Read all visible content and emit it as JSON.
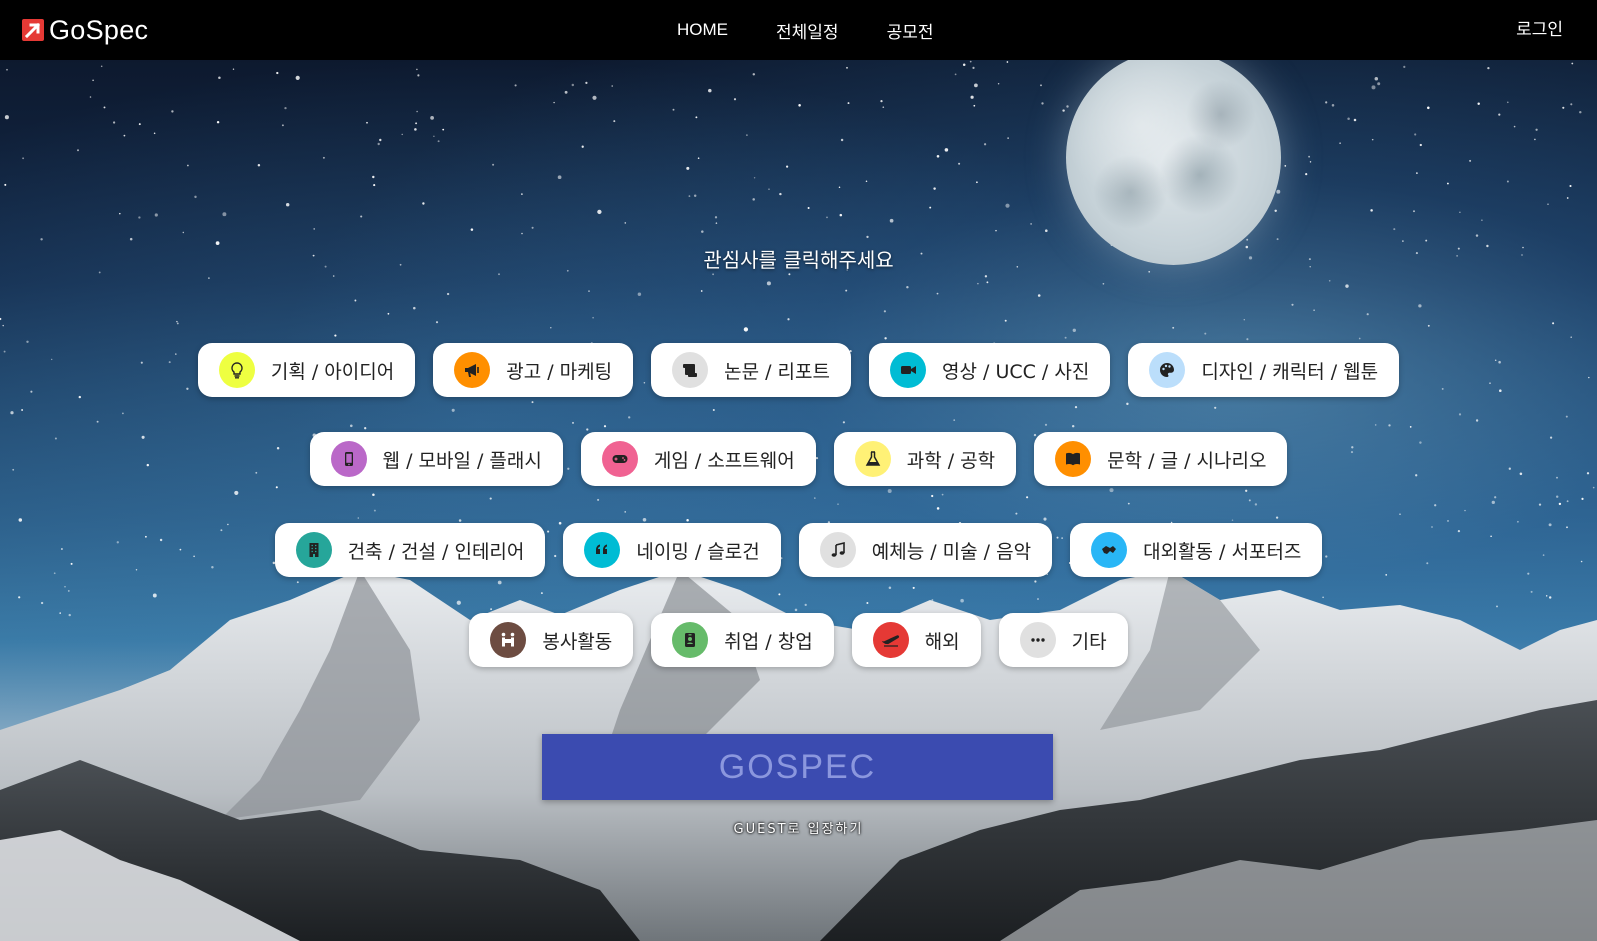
{
  "brand": {
    "name": "GoSpec",
    "color": "#e53935"
  },
  "nav": {
    "items": [
      {
        "label": "HOME"
      },
      {
        "label": "전체일정"
      },
      {
        "label": "공모전"
      }
    ],
    "login_label": "로그인"
  },
  "main": {
    "prompt": "관심사를 클릭해주세요",
    "category_rows": [
      [
        {
          "label": "기획 / 아이디어",
          "icon": "lightbulb-icon",
          "color": "#eeff41"
        },
        {
          "label": "광고 / 마케팅",
          "icon": "megaphone-icon",
          "color": "#ff8f00"
        },
        {
          "label": "논문 / 리포트",
          "icon": "scroll-icon",
          "color": "#e0e0e0"
        },
        {
          "label": "영상 / UCC / 사진",
          "icon": "video-camera-icon",
          "color": "#00bcd4"
        },
        {
          "label": "디자인 / 캐릭터 / 웹툰",
          "icon": "palette-icon",
          "color": "#bbdefb"
        }
      ],
      [
        {
          "label": "웹 / 모바일 / 플래시",
          "icon": "mobile-phone-icon",
          "color": "#ba68c8"
        },
        {
          "label": "게임 / 소프트웨어",
          "icon": "gamepad-icon",
          "color": "#f06292"
        },
        {
          "label": "과학 / 공학",
          "icon": "flask-icon",
          "color": "#fff176"
        },
        {
          "label": "문학 / 글 / 시나리오",
          "icon": "book-icon",
          "color": "#ff8f00"
        }
      ],
      [
        {
          "label": "건축 / 건설 / 인테리어",
          "icon": "building-icon",
          "color": "#26a69a"
        },
        {
          "label": "네이밍 / 슬로건",
          "icon": "quote-icon",
          "color": "#00bcd4"
        },
        {
          "label": "예체능 / 미술 / 음악",
          "icon": "music-note-icon",
          "color": "#e0e0e0"
        },
        {
          "label": "대외활동 / 서포터즈",
          "icon": "handshake-icon",
          "color": "#29b6f6"
        }
      ],
      [
        {
          "label": "봉사활동",
          "icon": "people-carry-icon",
          "color": "#6d4c41"
        },
        {
          "label": "취업 / 창업",
          "icon": "id-badge-icon",
          "color": "#66bb6a"
        },
        {
          "label": "해외",
          "icon": "plane-icon",
          "color": "#e53935"
        },
        {
          "label": "기타",
          "icon": "ellipsis-icon",
          "color": "#e0e0e0"
        }
      ]
    ],
    "cta_label": "GOSPEC",
    "cta_color": "#3b4bb0",
    "guest_label": "GUEST로 입장하기"
  }
}
